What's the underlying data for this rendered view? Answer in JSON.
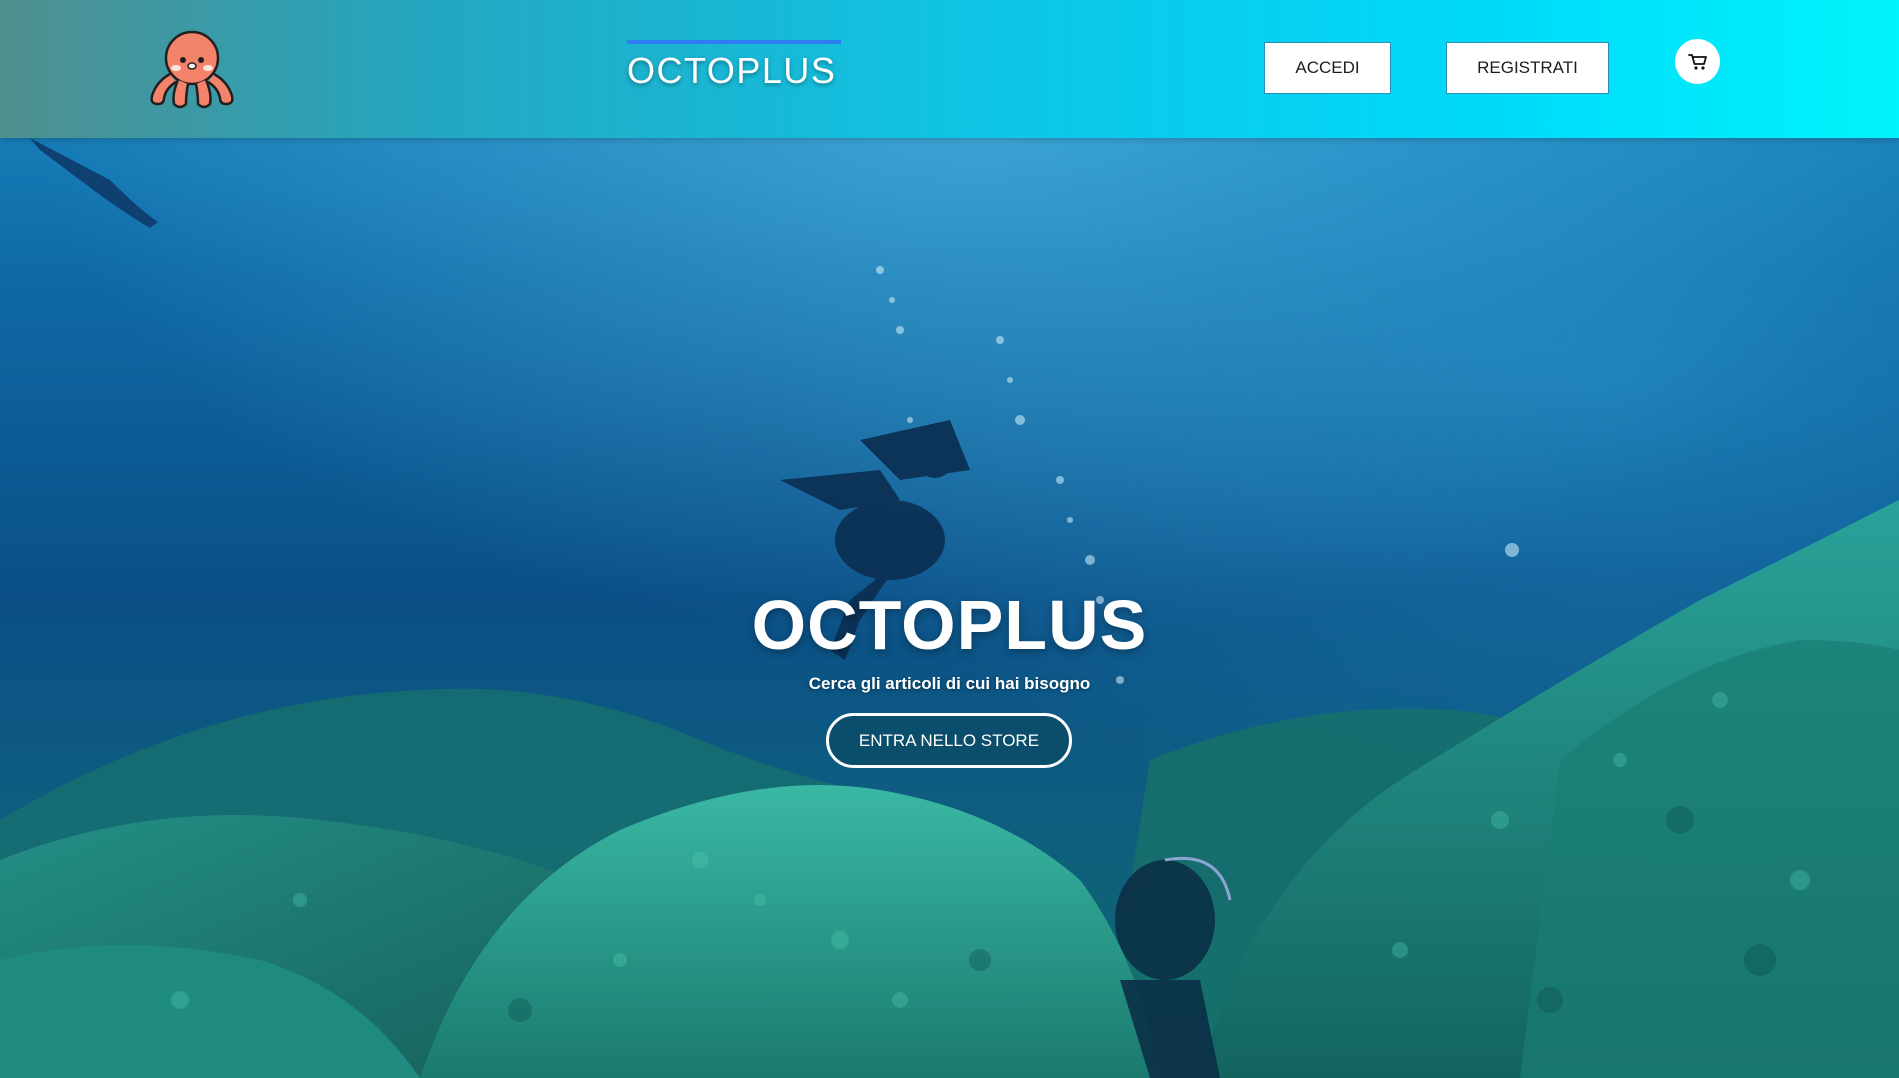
{
  "header": {
    "logo_icon": "octopus-logo-icon",
    "brand": "OCTOPLUS",
    "login_label": "ACCEDI",
    "register_label": "REGISTRATI",
    "cart_icon": "shopping-cart-icon"
  },
  "hero": {
    "title": "OCTOPLUS",
    "subtitle": "Cerca gli articoli di cui hai bisogno",
    "cta_label": "ENTRA NELLO STORE"
  },
  "colors": {
    "header_left": "#4f8f8e",
    "header_right": "#00f4fb",
    "brand_underline": "#2f7df3",
    "octopus": "#f4745f",
    "water_deep": "#0c4f86",
    "water_light": "#2aa6d6"
  }
}
